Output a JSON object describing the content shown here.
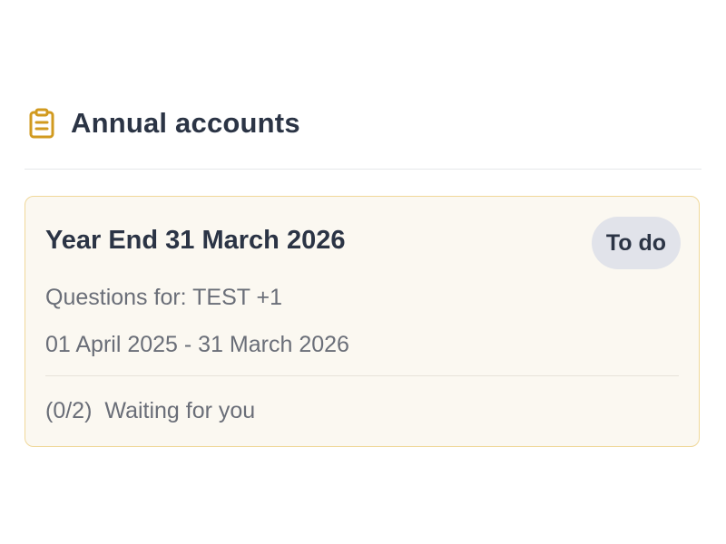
{
  "section": {
    "icon": "clipboard-icon",
    "title": "Annual accounts",
    "accent_color": "#d19a1f"
  },
  "task_card": {
    "title": "Year End 31 March 2026",
    "status": "To do",
    "questions_for": "Questions for: TEST +1",
    "period": "01 April 2025 - 31 March 2026",
    "progress": "(0/2)",
    "progress_status": "Waiting for you",
    "border_color": "#f0d89a",
    "background_color": "#fbf8f1"
  }
}
